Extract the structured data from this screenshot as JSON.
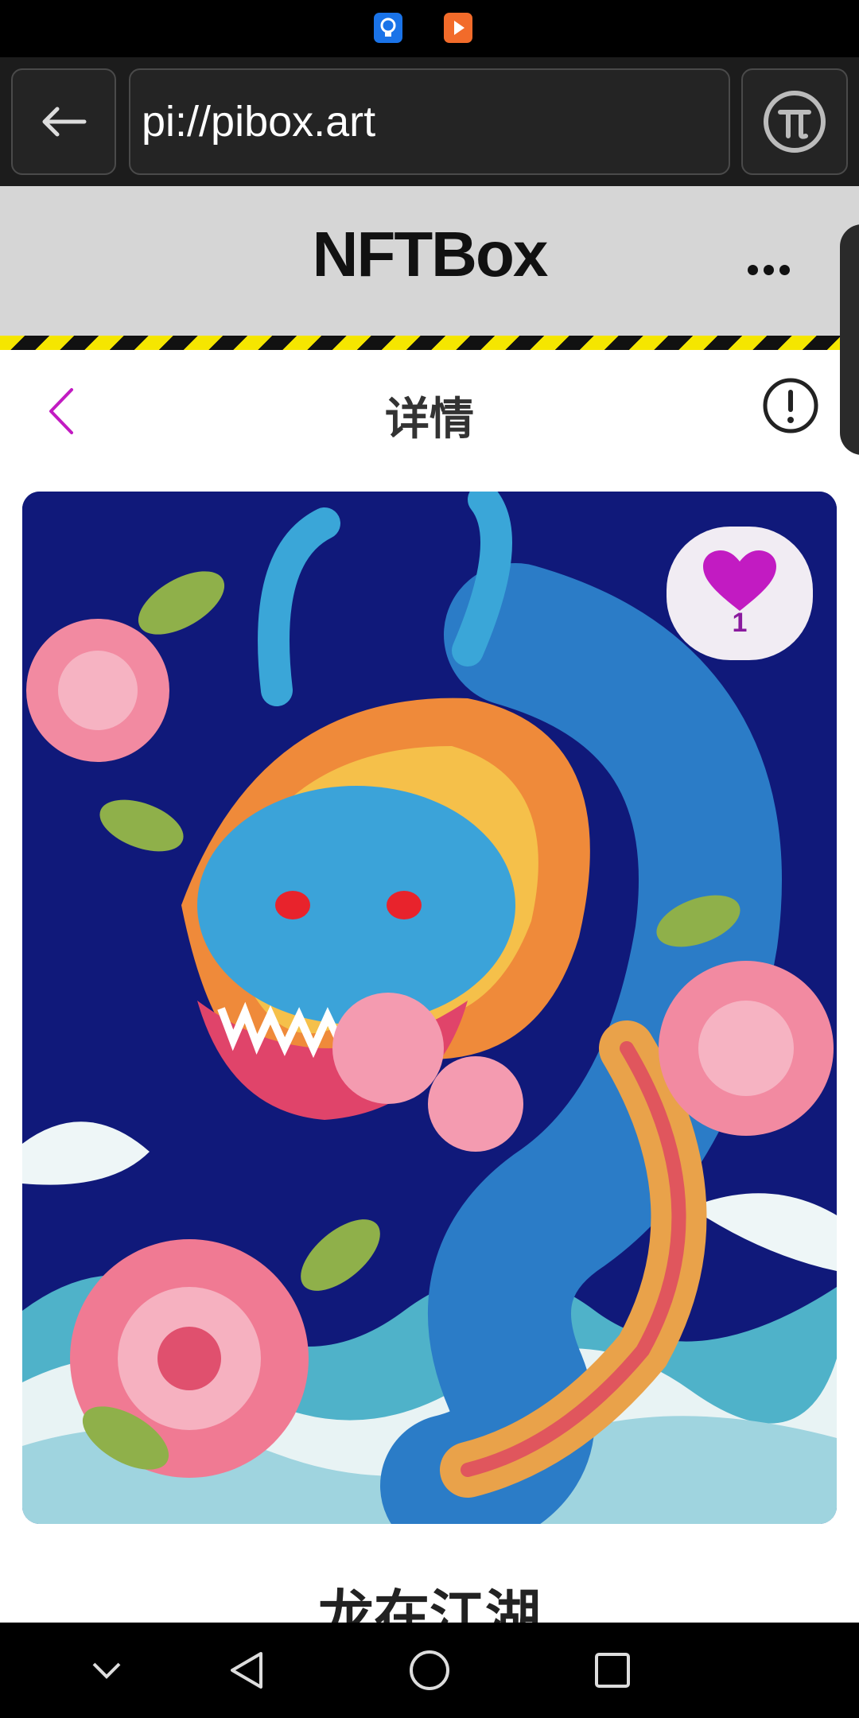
{
  "status_bar": {
    "icons": [
      "bulb-app-icon",
      "play-app-icon"
    ]
  },
  "browser": {
    "url": "pi://pibox.art",
    "back_icon": "arrow-left-icon",
    "menu_icon": "pi-logo-icon"
  },
  "header": {
    "title": "NFTBox",
    "more_icon": "more-dots-icon"
  },
  "detail": {
    "title": "详情",
    "back_icon": "chevron-left-icon",
    "info_icon": "info-circle-icon"
  },
  "nft": {
    "likes": "1",
    "name": "龙在江湖",
    "image": "dragon-artwork"
  },
  "nav": {
    "items": [
      "collapse-icon",
      "back-triangle-icon",
      "home-circle-icon",
      "recents-square-icon"
    ]
  },
  "colors": {
    "accent": "#c21bc2",
    "hazard_yellow": "#f5e600",
    "header_bg": "#d6d6d6"
  }
}
